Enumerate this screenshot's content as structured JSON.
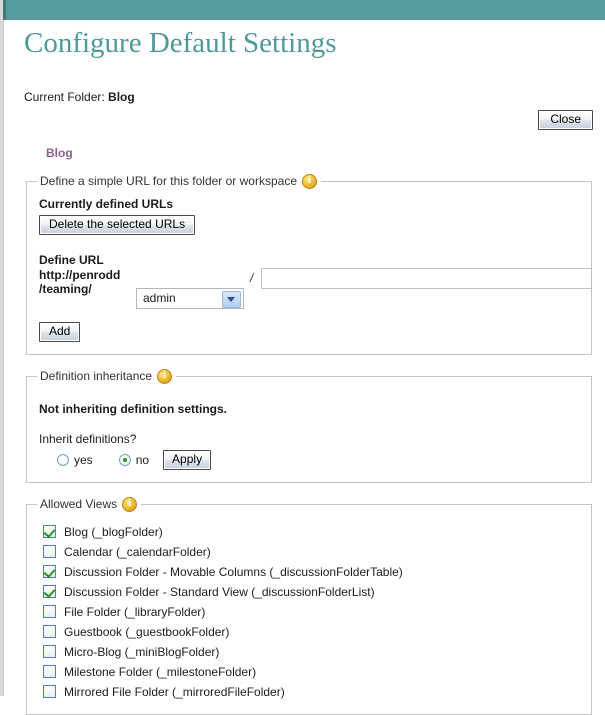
{
  "header": {
    "bar_color": "#559d9d",
    "title": "Configure Default Settings"
  },
  "folder": {
    "label": "Current Folder:",
    "name": "Blog"
  },
  "close_button": {
    "label": "Close"
  },
  "tabs": [
    {
      "label": "Blog",
      "color": "#8e5f8e",
      "active": true
    }
  ],
  "url_section": {
    "legend": "Define a simple URL for this folder or workspace",
    "info_icon": "info-icon",
    "currently_defined_label": "Currently defined URLs",
    "delete_button": "Delete the selected URLs",
    "define_url_label": "Define URL",
    "host_line1": "http://penrodd",
    "host_line2": "/teaming/",
    "select_value": "admin",
    "select_options": [
      "admin"
    ],
    "separator": "/",
    "path_value": "",
    "path_placeholder": "",
    "add_button": "Add"
  },
  "inheritance_section": {
    "legend": "Definition inheritance",
    "info_icon": "info-icon",
    "status": "Not inheriting definition settings.",
    "question": "Inherit definitions?",
    "options": [
      {
        "label": "yes",
        "checked": false
      },
      {
        "label": "no",
        "checked": true
      }
    ],
    "apply_button": "Apply"
  },
  "allowed_views": {
    "legend": "Allowed Views",
    "info_icon": "info-icon",
    "items": [
      {
        "label": "Blog (_blogFolder)",
        "checked": true
      },
      {
        "label": "Calendar (_calendarFolder)",
        "checked": false
      },
      {
        "label": "Discussion Folder - Movable Columns (_discussionFolderTable)",
        "checked": true
      },
      {
        "label": "Discussion Folder - Standard View (_discussionFolderList)",
        "checked": true
      },
      {
        "label": "File Folder (_libraryFolder)",
        "checked": false
      },
      {
        "label": "Guestbook (_guestbookFolder)",
        "checked": false
      },
      {
        "label": "Micro-Blog (_miniBlogFolder)",
        "checked": false
      },
      {
        "label": "Milestone Folder (_milestoneFolder)",
        "checked": false
      },
      {
        "label": "Mirrored File Folder (_mirroredFileFolder)",
        "checked": false
      }
    ]
  }
}
